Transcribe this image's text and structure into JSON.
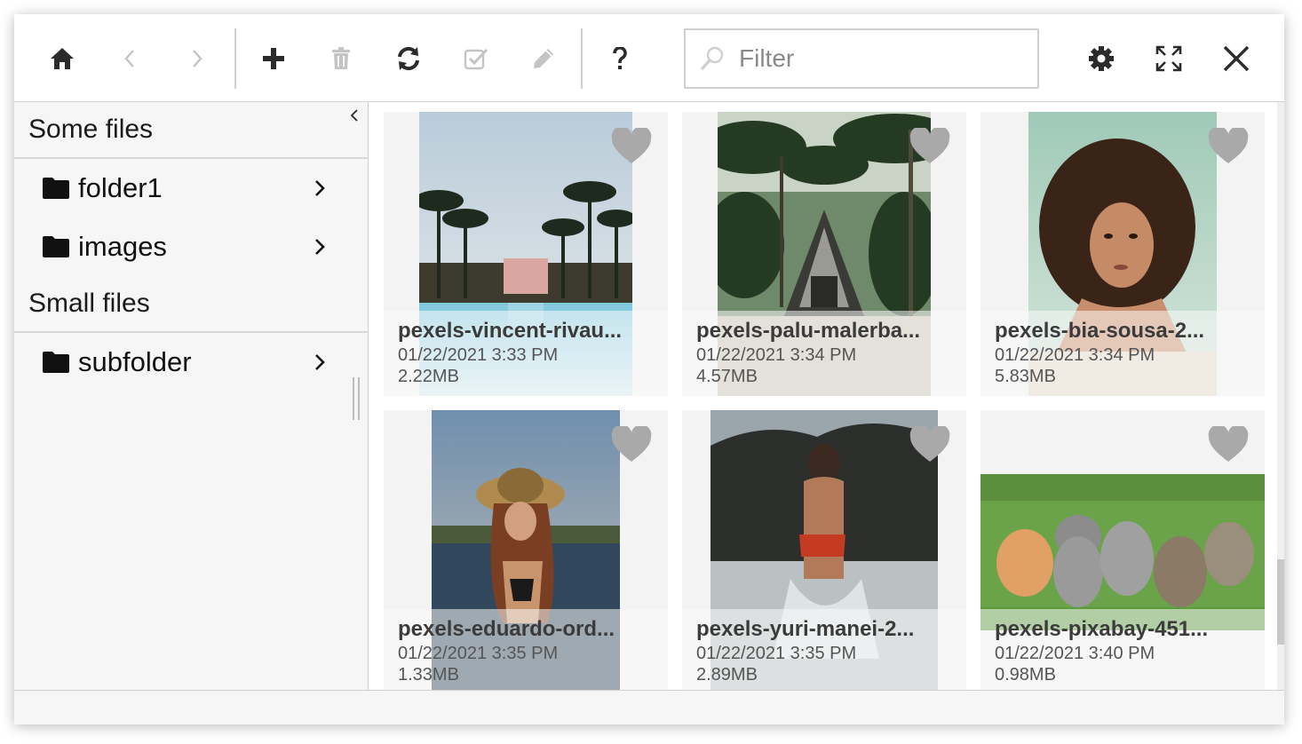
{
  "toolbar": {
    "buttons": [
      {
        "name": "home",
        "icon": "home-icon",
        "enabled": true
      },
      {
        "name": "back",
        "icon": "chevron-left-icon",
        "enabled": false
      },
      {
        "name": "forward",
        "icon": "chevron-right-icon",
        "enabled": false
      },
      {
        "name": "new",
        "icon": "plus-icon",
        "enabled": true
      },
      {
        "name": "delete",
        "icon": "trash-icon",
        "enabled": false
      },
      {
        "name": "refresh",
        "icon": "refresh-icon",
        "enabled": true
      },
      {
        "name": "select",
        "icon": "check-square-icon",
        "enabled": false
      },
      {
        "name": "rename",
        "icon": "pencil-icon",
        "enabled": false
      },
      {
        "name": "help",
        "icon": "question-icon",
        "enabled": true
      },
      {
        "name": "settings",
        "icon": "gear-icon",
        "enabled": true
      },
      {
        "name": "fullscreen",
        "icon": "expand-icon",
        "enabled": true
      },
      {
        "name": "close",
        "icon": "close-icon",
        "enabled": true
      }
    ],
    "filter": {
      "placeholder": "Filter",
      "value": ""
    }
  },
  "sidebar": {
    "sections": [
      {
        "title": "Some files",
        "folders": [
          {
            "label": "folder1"
          },
          {
            "label": "images"
          }
        ]
      },
      {
        "title": "Small files",
        "folders": [
          {
            "label": "subfolder"
          }
        ]
      }
    ]
  },
  "files": [
    {
      "name": "pexels-vincent-rivau...",
      "date": "01/22/2021 3:33 PM",
      "size": "2.22MB",
      "thumb": "palm-pool"
    },
    {
      "name": "pexels-palu-malerba...",
      "date": "01/22/2021 3:34 PM",
      "size": "4.57MB",
      "thumb": "jungle-cabin"
    },
    {
      "name": "pexels-bia-sousa-2...",
      "date": "01/22/2021 3:34 PM",
      "size": "5.83MB",
      "thumb": "curly-portrait"
    },
    {
      "name": "pexels-eduardo-ord...",
      "date": "01/22/2021 3:35 PM",
      "size": "1.33MB",
      "thumb": "hat-woman-lake"
    },
    {
      "name": "pexels-yuri-manei-2...",
      "date": "01/22/2021 3:35 PM",
      "size": "2.89MB",
      "thumb": "woman-splash"
    },
    {
      "name": "pexels-pixabay-451...",
      "date": "01/22/2021 3:40 PM",
      "size": "0.98MB",
      "thumb": "kittens-grass"
    }
  ],
  "colors": {
    "icon_active": "#2b2b2b",
    "icon_disabled": "#c4c4c4",
    "heart": "#a9a9a9"
  }
}
